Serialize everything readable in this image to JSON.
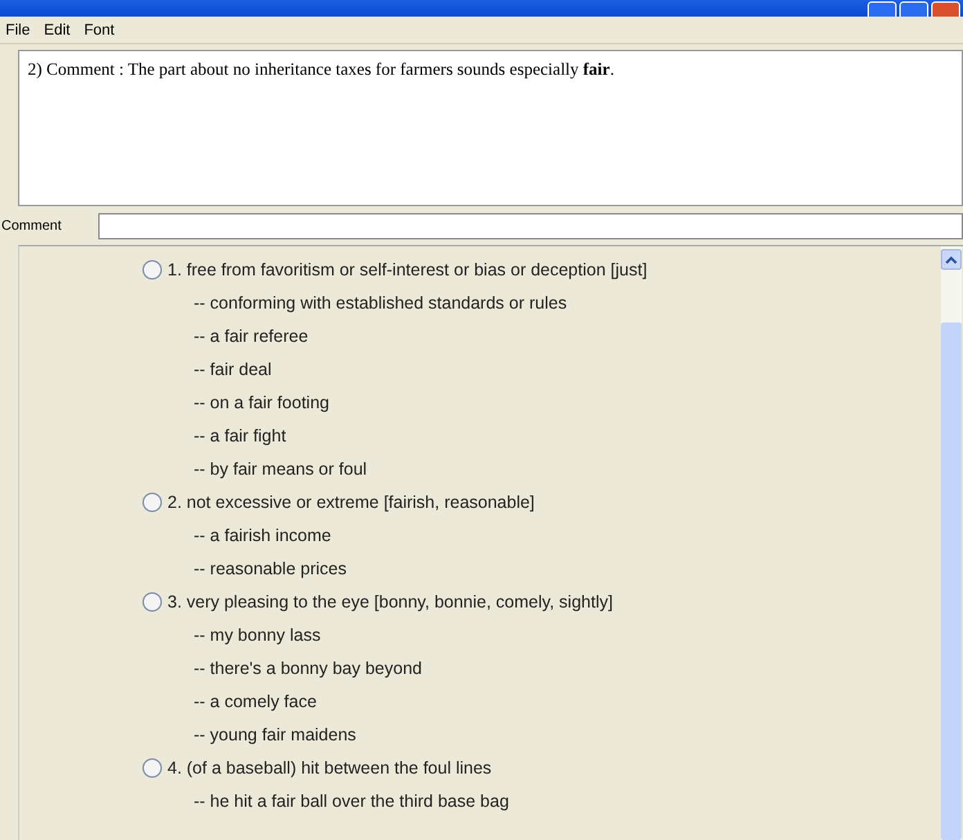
{
  "menu": [
    "File",
    "Edit",
    "Font"
  ],
  "comment_text": "2) Comment : The part about no inheritance taxes for farmers sounds especially **fair**.",
  "comment_field": {
    "label": "Comment"
  },
  "senses": [
    {
      "label": "1. free from favoritism or self-interest or bias or deception [just]",
      "selected": false,
      "examples": [
        "-- conforming with established standards or rules",
        "-- a fair referee",
        "-- fair deal",
        "-- on a fair footing",
        "-- a fair fight",
        "-- by fair means or foul"
      ]
    },
    {
      "label": "2. not excessive or extreme [fairish, reasonable]",
      "selected": false,
      "examples": [
        "-- a fairish income",
        "-- reasonable prices"
      ]
    },
    {
      "label": "3. very pleasing to the eye [bonny, bonnie, comely, sightly]",
      "selected": false,
      "examples": [
        "-- my bonny lass",
        "-- there's a bonny bay beyond",
        "-- a comely face",
        "-- young fair maidens"
      ]
    },
    {
      "label": "4. (of a baseball) hit between the foul lines",
      "selected": false,
      "examples": [
        "-- he hit a fair ball over the third base bag"
      ]
    }
  ]
}
